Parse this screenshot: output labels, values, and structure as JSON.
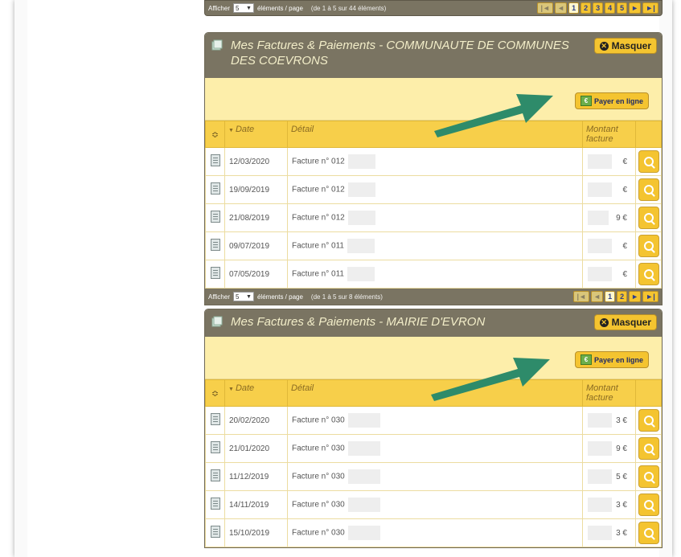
{
  "top_pager": {
    "show_label": "Afficher",
    "per_page": "5",
    "per_page_suffix": "éléments / page",
    "info": "(de 1 à 5 sur 44 éléments)",
    "pages": [
      "1",
      "2",
      "3",
      "4",
      "5"
    ],
    "first": "|◄",
    "prev": "◄",
    "next": "►",
    "last": "►|"
  },
  "sections": [
    {
      "title": "Mes Factures & Paiements - COMMUNAUTE DE COMMUNES DES COEVRONS",
      "hide_label": "Masquer",
      "pay_label": "Payer en ligne",
      "col_sort": "≎",
      "col_date": "Date",
      "col_detail": "Détail",
      "col_amount": "Montant facture",
      "rows": [
        {
          "date": "12/03/2020",
          "detail": "Facture n° 012",
          "amount": "€"
        },
        {
          "date": "19/09/2019",
          "detail": "Facture n° 012",
          "amount": "€"
        },
        {
          "date": "21/08/2019",
          "detail": "Facture n° 012",
          "amount": "9 €"
        },
        {
          "date": "09/07/2019",
          "detail": "Facture n° 011",
          "amount": "€"
        },
        {
          "date": "07/05/2019",
          "detail": "Facture n° 011",
          "amount": "€"
        }
      ],
      "pager": {
        "show_label": "Afficher",
        "per_page": "5",
        "per_page_suffix": "éléments / page",
        "info": "(de 1 à 5 sur 8 éléments)",
        "pages": [
          "1",
          "2"
        ],
        "first": "|◄",
        "prev": "◄",
        "next": "►",
        "last": "►|"
      }
    },
    {
      "title": "Mes Factures & Paiements - MAIRIE D'EVRON",
      "hide_label": "Masquer",
      "pay_label": "Payer en ligne",
      "col_sort": "≎",
      "col_date": "Date",
      "col_detail": "Détail",
      "col_amount": "Montant facture",
      "rows": [
        {
          "date": "20/02/2020",
          "detail": "Facture n° 030",
          "amount": "3 €"
        },
        {
          "date": "21/01/2020",
          "detail": "Facture n° 030",
          "amount": "9 €"
        },
        {
          "date": "11/12/2019",
          "detail": "Facture n° 030",
          "amount": "5 €"
        },
        {
          "date": "14/11/2019",
          "detail": "Facture n° 030",
          "amount": "3 €"
        },
        {
          "date": "15/10/2019",
          "detail": "Facture n° 030",
          "amount": "3 €"
        }
      ]
    }
  ],
  "colors": {
    "header_bg": "#7a7462",
    "accent": "#f4c430",
    "pay_bar": "#fdeeaa",
    "arrow": "#2e8b6a"
  }
}
